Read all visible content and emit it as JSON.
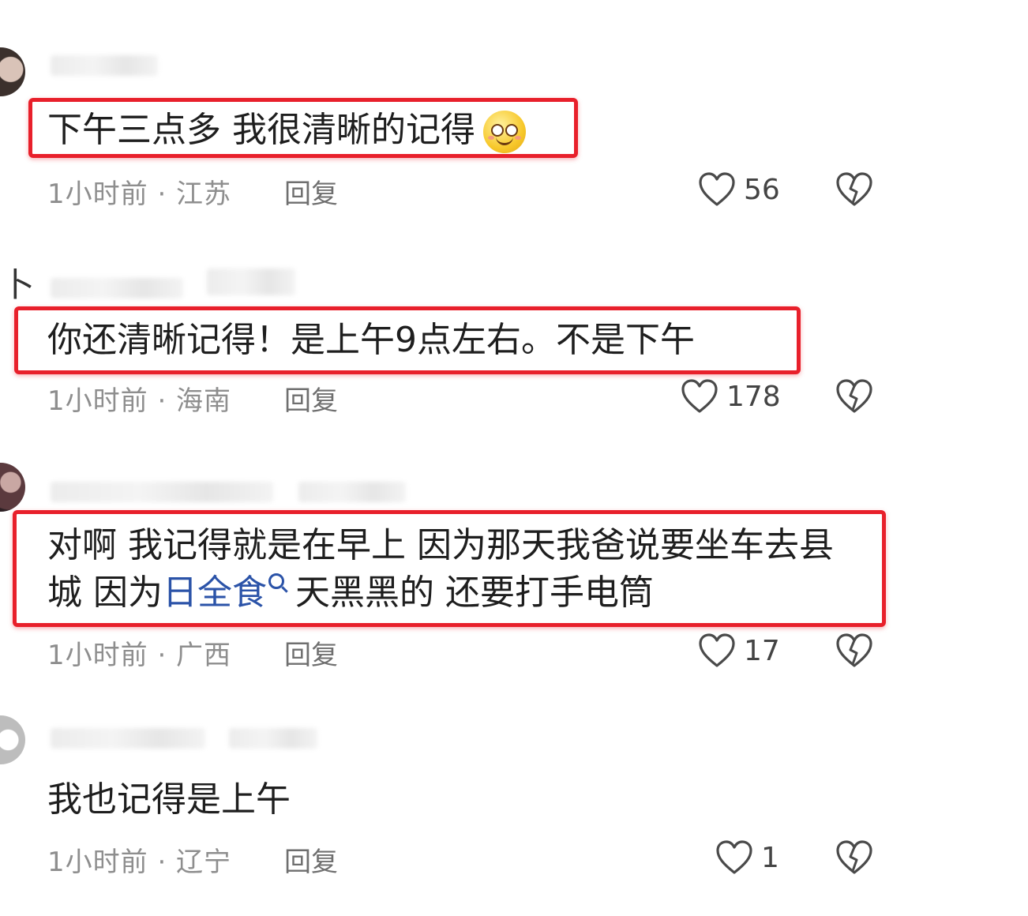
{
  "comments": [
    {
      "text": "下午三点多  我很清晰的记得",
      "emoji": "smiling-face-emoji",
      "meta": "1小时前 · 江苏",
      "reply": "回复",
      "likes": "56",
      "highlighted": true
    },
    {
      "text": "你还清晰记得！是上午9点左右。不是下午",
      "meta": "1小时前 · 海南",
      "reply": "回复",
      "likes": "178",
      "highlighted": true
    },
    {
      "line1": "对啊 我记得就是在早上  因为那天我爸说要坐车去县",
      "line2_pre": "城 因为",
      "line2_link": "日全食",
      "line2_post": " 天黑黑的 还要打手电筒",
      "meta": "1小时前 · 广西",
      "reply": "回复",
      "likes": "17",
      "highlighted": true
    },
    {
      "text": "我也记得是上午",
      "meta": "1小时前 · 辽宁",
      "reply": "回复",
      "likes": "1",
      "highlighted": false
    }
  ],
  "colors": {
    "highlight": "#e8202b",
    "link": "#2b53a8",
    "meta": "#8e8e8e"
  },
  "icons": [
    "heart-outline-icon",
    "broken-heart-icon",
    "search-icon"
  ]
}
